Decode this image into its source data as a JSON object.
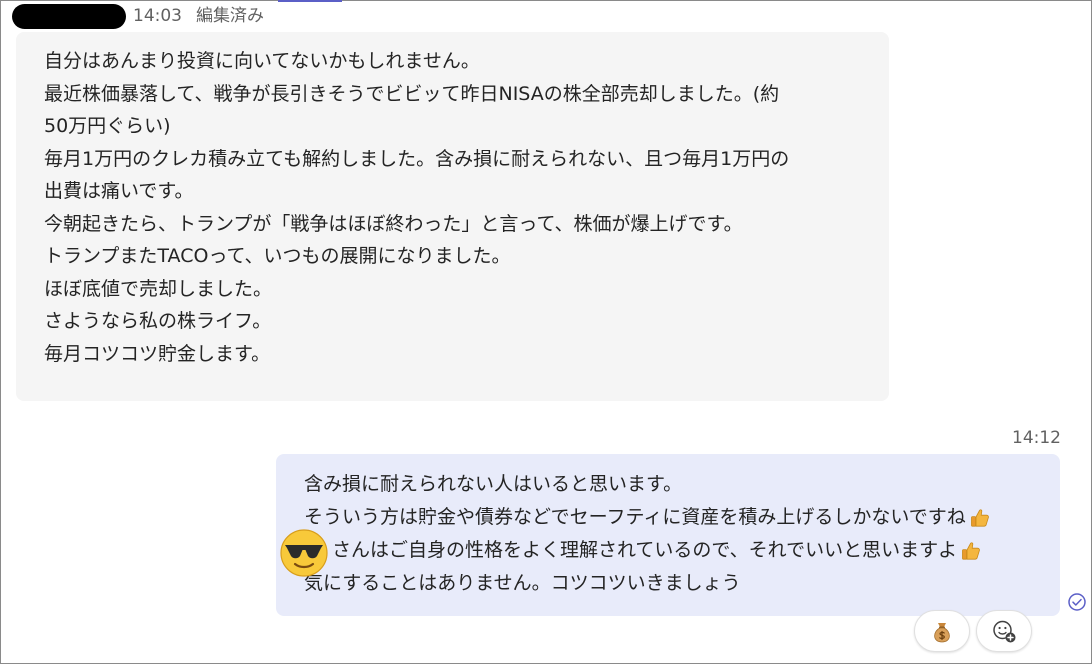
{
  "incoming": {
    "time": "14:03",
    "edited_label": "編集済み",
    "lines": [
      "自分はあんまり投資に向いてないかもしれません。",
      "最近株価暴落して、戦争が長引きそうでビビッて昨日NISAの株全部売却しました。(約",
      "50万円ぐらい)",
      "毎月1万円のクレカ積み立ても解約しました。含み損に耐えられない、且つ毎月1万円の",
      "出費は痛いです。",
      "今朝起きたら、トランプが「戦争はほぼ終わった」と言って、株価が爆上げです。",
      "トランプまたTACOって、いつもの展開になりました。",
      "ほぼ底値で売却しました。",
      "さようなら私の株ライフ。",
      "毎月コツコツ貯金します。"
    ]
  },
  "outgoing": {
    "time": "14:12",
    "lines": [
      "含み損に耐えられない人はいると思います。",
      "そういう方は貯金や債券などでセーフティに資産を積み上げるしかないですね",
      "さんはご自身の性格をよく理解されているので、それでいいと思いますよ",
      "気にすることはありません。コツコツいきましょう"
    ],
    "line1_emoji": "thumbs-up-icon",
    "line2_emoji": "thumbs-up-icon",
    "mention_emoji": "sunglasses-face-icon"
  },
  "reactions": {
    "existing": "money-bag-icon",
    "add": "add-reaction-icon"
  },
  "colors": {
    "incoming_bubble": "#f5f5f5",
    "outgoing_bubble": "#e8ebfa",
    "meta_text": "#616161",
    "accent": "#5b5fc7"
  }
}
